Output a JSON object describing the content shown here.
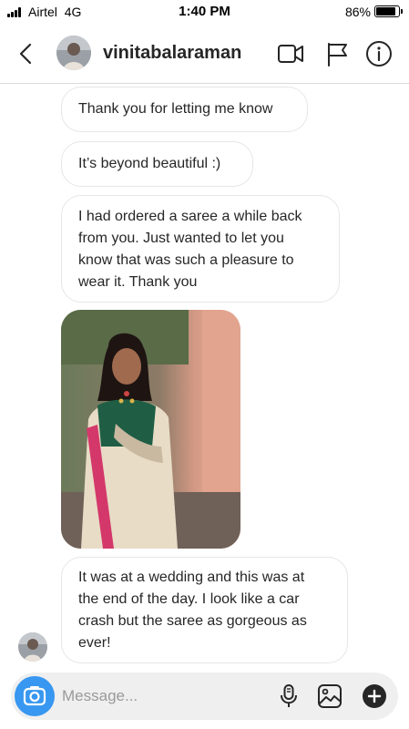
{
  "status": {
    "carrier": "Airtel",
    "network": "4G",
    "time": "1:40 PM",
    "battery": "86%",
    "battery_level": 0.86
  },
  "header": {
    "username": "vinitabalaraman",
    "icons": [
      "back-chevron",
      "video-camera",
      "flag",
      "info"
    ]
  },
  "messages": [
    {
      "type": "text",
      "text": "Thank you for letting me know"
    },
    {
      "type": "text",
      "text": "It’s beyond beautiful :)"
    },
    {
      "type": "text",
      "lines": [
        "I had ordered a saree a while back",
        "from you. Just wanted to let you",
        "know that was such a pleasure to",
        "wear it. Thank you"
      ]
    },
    {
      "type": "image",
      "description_icon": "photo"
    },
    {
      "type": "text",
      "lines": [
        "It was at a wedding and this was at",
        "the end of the day. I look like a car",
        "crash but the saree as gorgeous as",
        "ever!"
      ]
    }
  ],
  "composer": {
    "placeholder": "Message...",
    "icons": [
      "camera",
      "microphone",
      "gallery",
      "plus"
    ]
  },
  "colors": {
    "accent": "#3897f0",
    "bubble_border": "#e6e6e6",
    "composer_bg": "#efefef"
  }
}
